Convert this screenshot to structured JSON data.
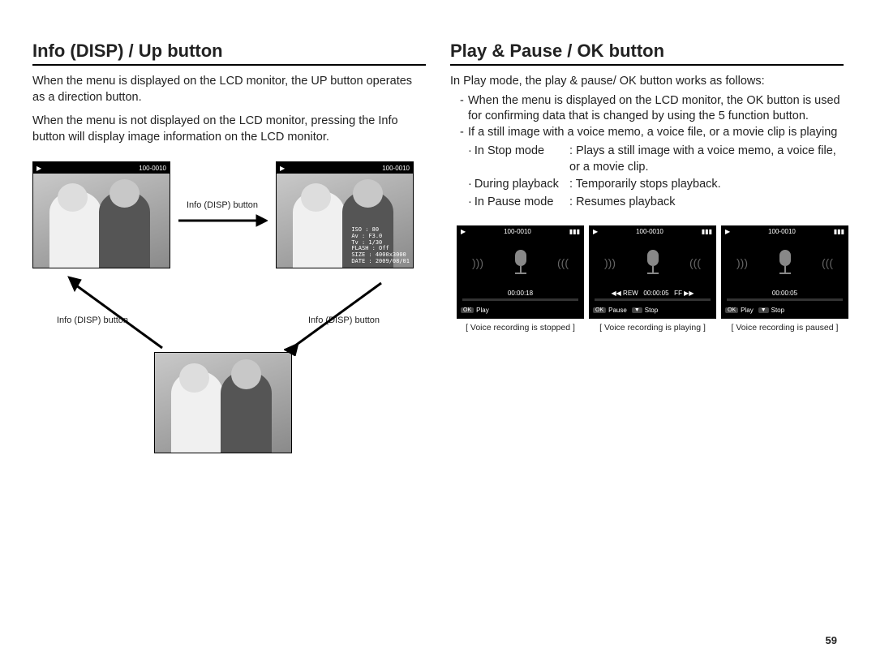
{
  "page_number": "59",
  "left": {
    "heading": "Info (DISP) / Up button",
    "para1": "When the menu is displayed on the LCD monitor, the UP button operates as a direction button.",
    "para2": "When the menu is not displayed on the LCD monitor, pressing the Info button will display image information on the LCD monitor.",
    "lcd_topbar": "100-0010",
    "info_label": "Info (DISP) button",
    "overlay": {
      "iso": "ISO : 80",
      "av": "Av : F3.0",
      "tv": "Tv : 1/30",
      "flash": "FLASH : Off",
      "size": "SIZE : 4000x3000",
      "date": "DATE : 2009/08/01"
    }
  },
  "right": {
    "heading": "Play & Pause / OK button",
    "para_intro": "In Play mode, the play & pause/ OK button works as follows:",
    "bullet1": "When the menu is displayed on the LCD monitor, the OK button is used for confirming data that is changed by using the 5 function button.",
    "bullet2": "If a still image with a voice memo, a voice file, or a movie clip is playing",
    "modes": [
      {
        "label": "In Stop mode",
        "desc": "Plays a still image with a voice memo, a voice file, or a movie clip."
      },
      {
        "label": "During playback",
        "desc": "Temporarily stops playback."
      },
      {
        "label": "In Pause mode",
        "desc": "Resumes playback"
      }
    ],
    "shots": [
      {
        "top": "100-0010",
        "time": "00:00:18",
        "foot": [
          {
            "k": "OK",
            "t": "Play"
          }
        ],
        "caption": "[ Voice recording is stopped ]"
      },
      {
        "top": "100-0010",
        "time": "00:00:05",
        "foot": [
          {
            "k": "OK",
            "t": "Pause"
          },
          {
            "k": "▼",
            "t": "Stop"
          }
        ],
        "caption": "[ Voice recording is playing ]"
      },
      {
        "top": "100-0010",
        "time": "00:00:05",
        "foot": [
          {
            "k": "OK",
            "t": "Play"
          },
          {
            "k": "▼",
            "t": "Stop"
          }
        ],
        "caption": "[ Voice recording is paused ]"
      }
    ]
  }
}
